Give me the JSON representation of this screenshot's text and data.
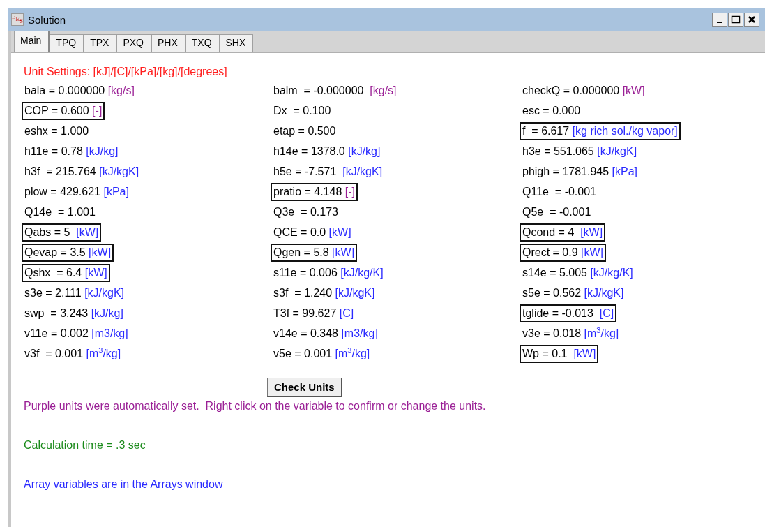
{
  "window": {
    "title": "Solution",
    "icon_letters": [
      "E",
      "E",
      "S"
    ]
  },
  "tabs": [
    {
      "label": "Main",
      "selected": true
    },
    {
      "label": "TPQ",
      "selected": false
    },
    {
      "label": "TPX",
      "selected": false
    },
    {
      "label": "PXQ",
      "selected": false
    },
    {
      "label": "PHX",
      "selected": false
    },
    {
      "label": "TXQ",
      "selected": false
    },
    {
      "label": "SHX",
      "selected": false
    }
  ],
  "unit_settings": "Unit Settings: [kJ]/[C]/[kPa]/[kg]/[degrees]",
  "variables": [
    {
      "text": "bala = 0.000000",
      "unit": "[kg/s]",
      "color": "#9a1f95",
      "boxed": false
    },
    {
      "text": "balm  = -0.000000 ",
      "unit": "[kg/s]",
      "color": "#9a1f95",
      "boxed": false
    },
    {
      "text": "checkQ = 0.000000",
      "unit": "[kW]",
      "color": "#9a1f95",
      "boxed": false
    },
    {
      "text": "COP = 0.600",
      "unit": "[-]",
      "color": "#9a1f95",
      "boxed": true
    },
    {
      "text": "Dx  = 0.100",
      "boxed": false
    },
    {
      "text": "esc = 0.000",
      "boxed": false
    },
    {
      "text": "eshx = 1.000",
      "boxed": false
    },
    {
      "text": "etap = 0.500",
      "boxed": false
    },
    {
      "text": "f  = 6.617",
      "unit": "[kg rich sol./kg vapor]",
      "color": "#2a2aff",
      "boxed": true
    },
    {
      "text": "h11e = 0.78",
      "unit": "[kJ/kg]",
      "color": "#2a2aff",
      "boxed": false
    },
    {
      "text": "h14e = 1378.0",
      "unit": "[kJ/kg]",
      "color": "#2a2aff",
      "boxed": false
    },
    {
      "text": "h3e = 551.065",
      "unit": "[kJ/kgK]",
      "color": "#2a2aff",
      "boxed": false
    },
    {
      "text": "h3f  = 215.764",
      "unit": "[kJ/kgK]",
      "color": "#2a2aff",
      "boxed": false
    },
    {
      "text": "h5e = -7.571 ",
      "unit": "[kJ/kgK]",
      "color": "#2a2aff",
      "boxed": false
    },
    {
      "text": "phigh = 1781.945",
      "unit": "[kPa]",
      "color": "#2a2aff",
      "boxed": false
    },
    {
      "text": "plow = 429.621",
      "unit": "[kPa]",
      "color": "#2a2aff",
      "boxed": false
    },
    {
      "text": "pratio = 4.148",
      "unit": "[-]",
      "color": "#9a1f95",
      "boxed": true
    },
    {
      "text": "Q11e  = -0.001",
      "boxed": false
    },
    {
      "text": "Q14e  = 1.001",
      "boxed": false
    },
    {
      "text": "Q3e  = 0.173",
      "boxed": false
    },
    {
      "text": "Q5e  = -0.001",
      "boxed": false
    },
    {
      "text": "Qabs = 5 ",
      "unit": "[kW]",
      "color": "#2a2aff",
      "boxed": true
    },
    {
      "text": "QCE = 0.0",
      "unit": "[kW]",
      "color": "#2a2aff",
      "boxed": false
    },
    {
      "text": "Qcond = 4 ",
      "unit": "[kW]",
      "color": "#2a2aff",
      "boxed": true
    },
    {
      "text": "Qevap = 3.5",
      "unit": "[kW]",
      "color": "#2a2aff",
      "boxed": true
    },
    {
      "text": "Qgen = 5.8",
      "unit": "[kW]",
      "color": "#2a2aff",
      "boxed": true
    },
    {
      "text": "Qrect = 0.9",
      "unit": "[kW]",
      "color": "#2a2aff",
      "boxed": true
    },
    {
      "text": "Qshx  = 6.4",
      "unit": "[kW]",
      "color": "#2a2aff",
      "boxed": true
    },
    {
      "text": "s11e = 0.006",
      "unit": "[kJ/kg/K]",
      "color": "#2a2aff",
      "boxed": false
    },
    {
      "text": "s14e = 5.005",
      "unit": "[kJ/kg/K]",
      "color": "#2a2aff",
      "boxed": false
    },
    {
      "text": "s3e = 2.111",
      "unit": "[kJ/kgK]",
      "color": "#2a2aff",
      "boxed": false
    },
    {
      "text": "s3f  = 1.240",
      "unit": "[kJ/kgK]",
      "color": "#2a2aff",
      "boxed": false
    },
    {
      "text": "s5e = 0.562",
      "unit": "[kJ/kgK]",
      "color": "#2a2aff",
      "boxed": false
    },
    {
      "text": "swp  = 3.243",
      "unit": "[kJ/kg]",
      "color": "#2a2aff",
      "boxed": false
    },
    {
      "text": "T3f = 99.627",
      "unit": "[C]",
      "color": "#2a2aff",
      "boxed": false
    },
    {
      "text": "tglide = -0.013 ",
      "unit": "[C]",
      "color": "#2a2aff",
      "boxed": true
    },
    {
      "text": "v11e = 0.002",
      "unit": "[m3/kg]",
      "color": "#2a2aff",
      "boxed": false
    },
    {
      "text": "v14e = 0.348",
      "unit": "[m3/kg]",
      "color": "#2a2aff",
      "boxed": false
    },
    {
      "text": "v3e = 0.018",
      "unit": "[m$^{3}$/kg]",
      "color": "#2a2aff",
      "boxed": false
    },
    {
      "text": "v3f  = 0.001",
      "unit": "[m$^{3}$/kg]",
      "color": "#2a2aff",
      "boxed": false
    },
    {
      "text": "v5e = 0.001",
      "unit": "[m$^{3}$/kg]",
      "color": "#2a2aff",
      "boxed": false
    },
    {
      "text": "Wp = 0.1 ",
      "unit": "[kW]",
      "color": "#2a2aff",
      "boxed": true
    }
  ],
  "check_button": "Check Units",
  "notes": [
    {
      "text": "Purple units were automatically set.  Right click on the variable to confirm or change the units.",
      "kind": "info"
    },
    {
      "text": "Calculation time = .3 sec",
      "kind": "timing"
    },
    {
      "text": "Array variables are in the Arrays window",
      "kind": "link"
    }
  ]
}
